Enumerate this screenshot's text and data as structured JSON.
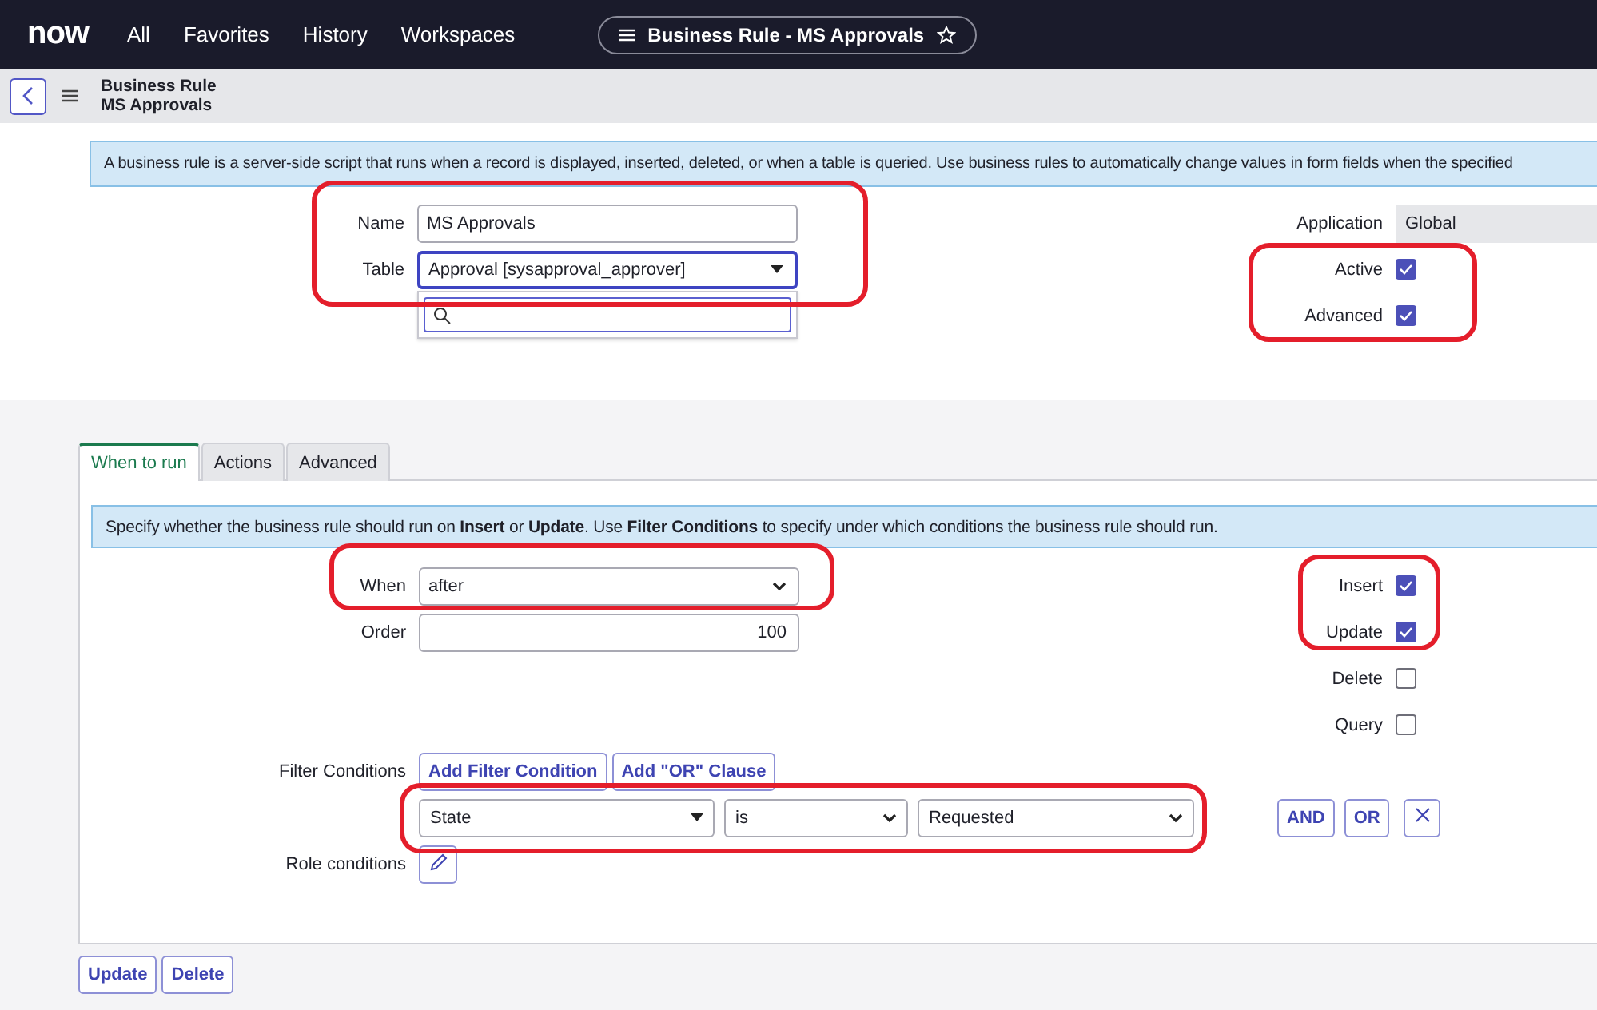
{
  "nav": {
    "logo": "now",
    "items": [
      "All",
      "Favorites",
      "History",
      "Workspaces"
    ],
    "record_title": "Business Rule - MS Approvals"
  },
  "header": {
    "title": "Business Rule",
    "subtitle": "MS Approvals"
  },
  "form": {
    "info": "A business rule is a server-side script that runs when a record is displayed, inserted, deleted, or when a table is queried. Use business rules to automatically change values in form fields when the specified",
    "name": {
      "label": "Name",
      "value": "MS Approvals"
    },
    "table": {
      "label": "Table",
      "value": "Approval [sysapproval_approver]"
    },
    "application": {
      "label": "Application",
      "value": "Global"
    },
    "checkboxes": [
      {
        "label": "Active",
        "checked": true
      },
      {
        "label": "Advanced",
        "checked": true
      }
    ]
  },
  "tabs": [
    {
      "label": "When to run",
      "selected": true
    },
    {
      "label": "Actions",
      "selected": false
    },
    {
      "label": "Advanced",
      "selected": false
    }
  ],
  "when_to_run": {
    "info": "Specify whether the business rule should run on **Insert** or **Update**. Use **Filter Conditions** to specify under which conditions the business rule should run.",
    "when": {
      "label": "When",
      "value": "after"
    },
    "order": {
      "label": "Order",
      "value": "100"
    },
    "checkboxes": [
      {
        "label": "Insert",
        "checked": true
      },
      {
        "label": "Update",
        "checked": true
      },
      {
        "label": "Delete",
        "checked": false
      },
      {
        "label": "Query",
        "checked": false
      }
    ],
    "filter": {
      "label": "Filter Conditions",
      "buttons": [
        "Add Filter Condition",
        "Add \"OR\" Clause"
      ],
      "field": "State",
      "operator": "is",
      "value": "Requested",
      "joins": [
        "AND",
        "OR"
      ]
    },
    "role": {
      "label": "Role conditions"
    }
  },
  "actions": [
    "Update",
    "Delete"
  ]
}
